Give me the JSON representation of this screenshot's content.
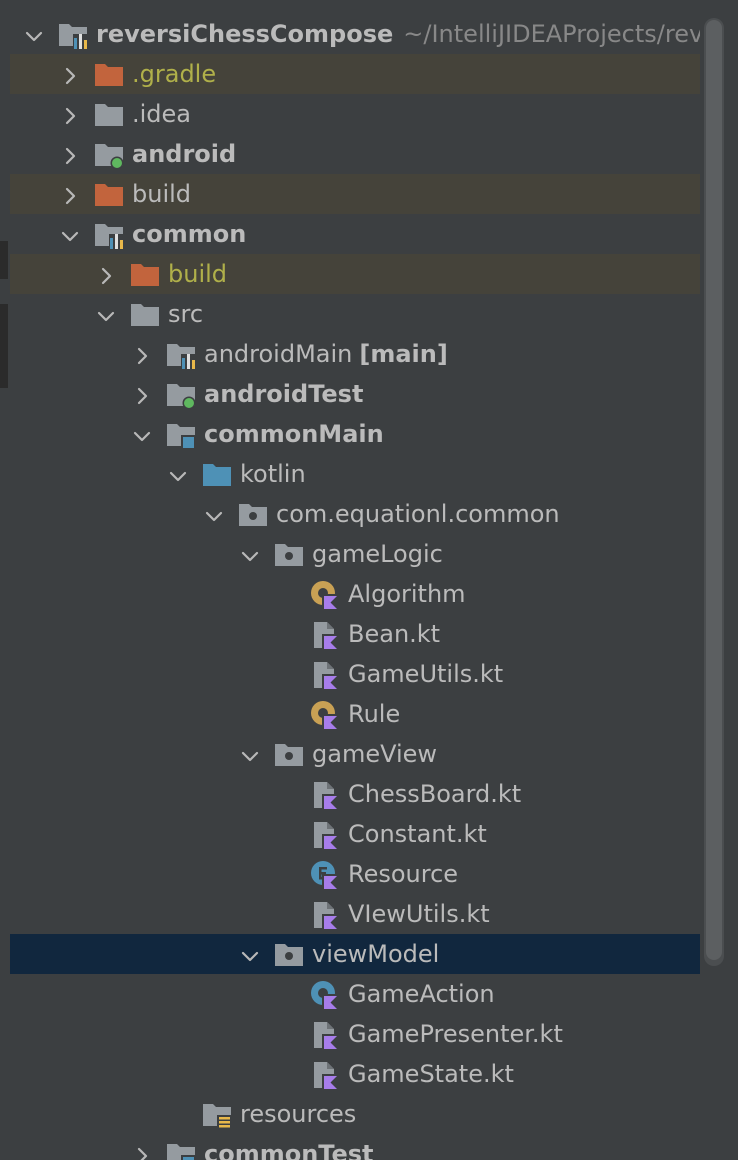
{
  "colors": {
    "background": "#3c3f41",
    "text": "#bbbbbb",
    "excluded_text": "#b0b04a",
    "excluded_row": "#45433a",
    "selected_row": "#11273e",
    "hint_text": "#888888"
  },
  "project_tree": {
    "rows": [
      {
        "label": "reversiChessCompose",
        "hint": "~/IntelliJIDEAProjects/rev",
        "icon": "module-folder-icon",
        "expanded": true,
        "bold": true
      },
      {
        "label": ".gradle",
        "icon": "excluded-folder-icon",
        "expanded": false,
        "excluded": true
      },
      {
        "label": ".idea",
        "icon": "folder-icon",
        "expanded": false
      },
      {
        "label": "android",
        "icon": "android-module-icon",
        "expanded": false,
        "bold": true
      },
      {
        "label": "build",
        "icon": "excluded-folder-icon",
        "expanded": false
      },
      {
        "label": "common",
        "icon": "module-folder-icon",
        "expanded": true,
        "bold": true
      },
      {
        "label": "build",
        "icon": "excluded-folder-icon",
        "expanded": false,
        "excluded": true
      },
      {
        "label": "src",
        "icon": "folder-icon",
        "expanded": true
      },
      {
        "label": "androidMain",
        "suffix": "[main]",
        "icon": "module-folder-icon",
        "expanded": false
      },
      {
        "label": "androidTest",
        "icon": "android-test-folder-icon",
        "expanded": false,
        "bold": true
      },
      {
        "label": "commonMain",
        "icon": "source-set-folder-icon",
        "expanded": true,
        "bold": true
      },
      {
        "label": "kotlin",
        "icon": "source-folder-icon",
        "expanded": true
      },
      {
        "label": "com.equationl.common",
        "icon": "package-icon",
        "expanded": true
      },
      {
        "label": "gameLogic",
        "icon": "package-icon",
        "expanded": true
      },
      {
        "label": "Algorithm",
        "icon": "kotlin-class-icon"
      },
      {
        "label": "Bean.kt",
        "icon": "kotlin-file-icon"
      },
      {
        "label": "GameUtils.kt",
        "icon": "kotlin-file-icon"
      },
      {
        "label": "Rule",
        "icon": "kotlin-class-icon"
      },
      {
        "label": "gameView",
        "icon": "package-icon",
        "expanded": true
      },
      {
        "label": "ChessBoard.kt",
        "icon": "kotlin-file-icon"
      },
      {
        "label": "Constant.kt",
        "icon": "kotlin-file-icon"
      },
      {
        "label": "Resource",
        "icon": "kotlin-enum-icon"
      },
      {
        "label": "VIewUtils.kt",
        "icon": "kotlin-file-icon"
      },
      {
        "label": "viewModel",
        "icon": "package-icon",
        "expanded": true,
        "selected": true
      },
      {
        "label": "GameAction",
        "icon": "kotlin-sealed-class-icon"
      },
      {
        "label": "GamePresenter.kt",
        "icon": "kotlin-file-icon"
      },
      {
        "label": "GameState.kt",
        "icon": "kotlin-file-icon"
      },
      {
        "label": "resources",
        "icon": "resources-folder-icon"
      },
      {
        "label": "commonTest",
        "icon": "source-set-folder-icon",
        "expanded": false,
        "bold": true
      }
    ]
  }
}
